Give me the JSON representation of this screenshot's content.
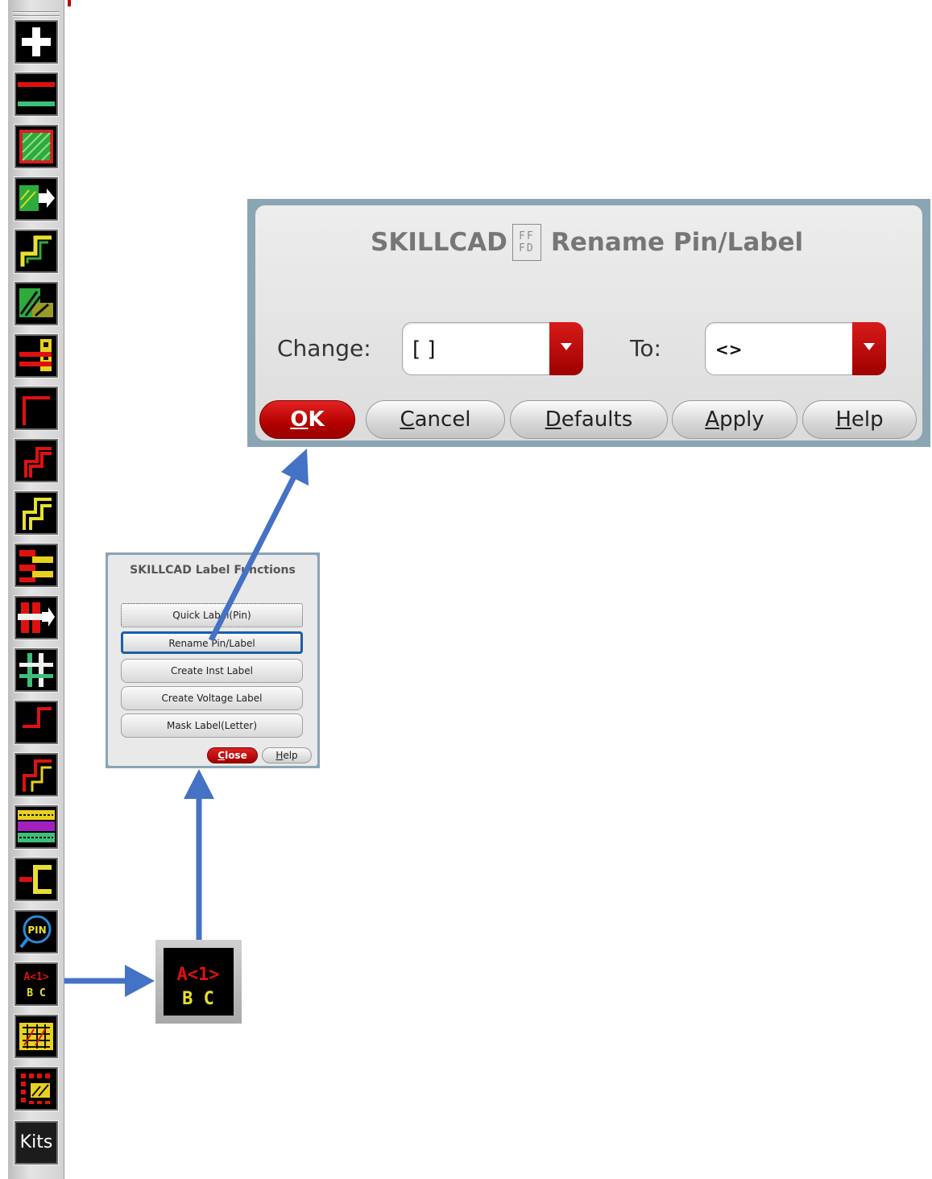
{
  "toolbar": {
    "buttons": [
      {
        "name": "add-icon"
      },
      {
        "name": "wire-lines-icon"
      },
      {
        "name": "fill-rect-icon"
      },
      {
        "name": "move-shape-icon"
      },
      {
        "name": "step-path-icon"
      },
      {
        "name": "hatch-fill-icon"
      },
      {
        "name": "bus-stack-icon"
      },
      {
        "name": "single-step-icon"
      },
      {
        "name": "double-step-icon"
      },
      {
        "name": "yellow-step-icon"
      },
      {
        "name": "stacked-bars-icon"
      },
      {
        "name": "shield-move-icon"
      },
      {
        "name": "cross-grid-icon"
      },
      {
        "name": "corner-step-icon"
      },
      {
        "name": "red-step-icon"
      },
      {
        "name": "layer-stack-icon"
      },
      {
        "name": "bracket-connect-icon"
      },
      {
        "name": "pin-search-icon"
      },
      {
        "name": "label-functions-icon",
        "text_top": "A<1>",
        "text_bottom": "B C"
      },
      {
        "name": "grid-pattern-icon"
      },
      {
        "name": "array-icon"
      }
    ],
    "kits_label": "Kits"
  },
  "rename_dialog": {
    "title_left": "SKILLCAD",
    "logo_top": "FF",
    "logo_bottom": "FD",
    "title_right": "Rename Pin/Label",
    "change_label": "Change:",
    "change_value": "[ ]",
    "to_label": "To:",
    "to_value": "<>",
    "buttons": {
      "ok": {
        "first": "O",
        "rest": "K"
      },
      "cancel": {
        "first": "C",
        "rest": "ancel"
      },
      "defaults": {
        "first": "D",
        "rest": "efaults"
      },
      "apply": {
        "first": "A",
        "rest": "pply"
      },
      "help": {
        "first": "H",
        "rest": "elp"
      }
    }
  },
  "label_dialog": {
    "title": "SKILLCAD Label Functions",
    "items": [
      "Quick Label(Pin)",
      "Rename Pin/Label",
      "Create Inst Label",
      "Create Voltage Label",
      "Mask Label(Letter)"
    ],
    "close": {
      "first": "C",
      "rest": "lose"
    },
    "help": {
      "first": "H",
      "rest": "elp"
    }
  },
  "zoom_icon": {
    "text_top": "A<1>",
    "text_bottom": "B C"
  },
  "colors": {
    "accent_red": "#c00000",
    "arrow_blue": "#4472c4",
    "selected_border": "#1b5fa8",
    "dialog_frame": "#8aa5b4"
  }
}
